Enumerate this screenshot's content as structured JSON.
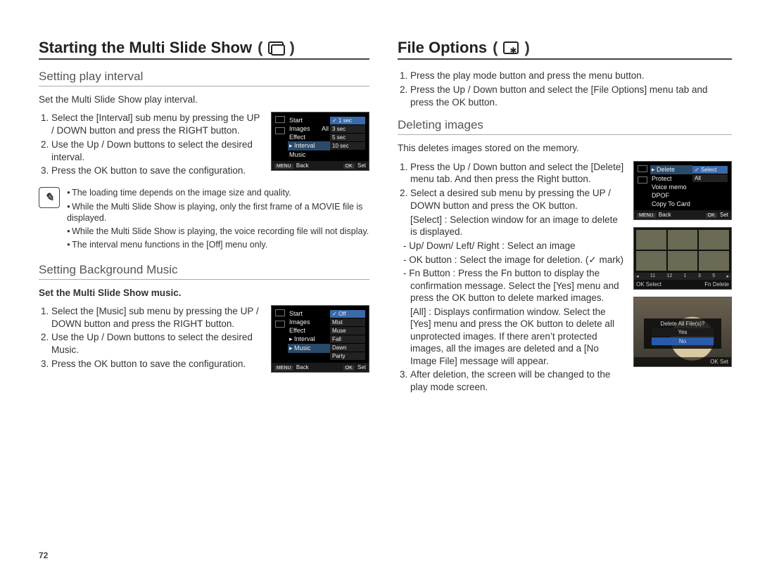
{
  "page_number": "72",
  "left": {
    "title": "Starting the Multi Slide Show",
    "section1": {
      "heading": "Setting play interval",
      "intro": "Set the Multi Slide Show play interval.",
      "steps": [
        "Select the [Interval] sub menu by pressing the UP / DOWN button and press the RIGHT button.",
        "Use the Up / Down buttons to select the desired interval.",
        "Press the OK button to save the configuration."
      ],
      "thumb": {
        "rows": [
          "Start",
          "Images",
          "Effect",
          "Interval",
          "Music"
        ],
        "row_vals": [
          "",
          "All",
          "",
          "",
          ""
        ],
        "selected_row": "Interval",
        "options": [
          "1 sec",
          "3 sec",
          "5 sec",
          "10 sec"
        ],
        "selected_option": "1 sec",
        "foot_left_btn": "MENU",
        "foot_left": "Back",
        "foot_right_btn": "OK",
        "foot_right": "Set"
      },
      "notes": [
        "The loading time depends on the image size and quality.",
        "While the Multi Slide Show is playing, only the first frame of a MOVIE file is displayed.",
        "While the Multi Slide Show is playing, the voice recording file will not display.",
        "The interval menu functions in the [Off] menu only."
      ]
    },
    "section2": {
      "heading": "Setting Background Music",
      "intro": "Set the Multi Slide Show music.",
      "steps": [
        "Select the [Music] sub menu by pressing the UP / DOWN button and press the RIGHT button.",
        "Use the Up / Down buttons to select the desired Music.",
        "Press the OK button to save the configuration."
      ],
      "thumb": {
        "rows": [
          "Start",
          "Images",
          "Effect",
          "Interval",
          "Music"
        ],
        "selected_row": "Music",
        "options": [
          "Off",
          "Mist",
          "Muse",
          "Fall",
          "Dawn",
          "Party"
        ],
        "selected_option": "Off",
        "foot_left_btn": "MENU",
        "foot_left": "Back",
        "foot_right_btn": "OK",
        "foot_right": "Set"
      }
    }
  },
  "right": {
    "title": "File Options",
    "intro_steps": [
      "Press the play mode button and press the menu button.",
      "Press the Up / Down button and select the [File Options] menu tab and press the OK button."
    ],
    "section1": {
      "heading": "Deleting images",
      "intro": "This deletes images stored on the memory.",
      "steps": {
        "s1": "Press the Up / Down button and select the [Delete] menu tab. And then press the Right button.",
        "s2": "Select a desired sub menu by pressing the UP / DOWN button and press the OK button.",
        "s2_select_label": "[Select] :",
        "s2_select_body": "Selection window for an image to delete is displayed.",
        "s2_updown": "Up/ Down/ Left/ Right : Select an image",
        "s2_ok": "OK button : Select the image for deletion. (",
        "s2_ok_tail": " mark)",
        "s2_fn": "Fn Button : Press the Fn button to display the confirmation message. Select the [Yes] menu and press the OK button to delete marked images.",
        "s2_all_label": "[All] :",
        "s2_all_body": "Displays confirmation window. Select the [Yes] menu and press the OK button to delete all unprotected images. If there aren’t protected images, all the images are deleted and a [No Image File] message will appear.",
        "s3": "After deletion, the screen will be changed to the play mode screen."
      },
      "thumb_menu": {
        "rows": [
          "Delete",
          "Protect",
          "Voice memo",
          "DPOF",
          "Copy To Card"
        ],
        "selected_row": "Delete",
        "options": [
          "Select",
          "All"
        ],
        "selected_option": "Select",
        "foot_left_btn": "MENU",
        "foot_left": "Back",
        "foot_right_btn": "OK",
        "foot_right": "Set"
      },
      "thumb_grid": {
        "strip": [
          "11",
          "12",
          "1",
          "3",
          "5"
        ],
        "foot_left_btn": "OK",
        "foot_left": "Select",
        "foot_right_btn": "Fn",
        "foot_right": "Delete"
      },
      "thumb_dialog": {
        "title": "Delete All File(s)?",
        "opts": [
          "Yes",
          "No"
        ],
        "selected": "No",
        "foot_btn": "OK",
        "foot": "Set"
      }
    }
  }
}
